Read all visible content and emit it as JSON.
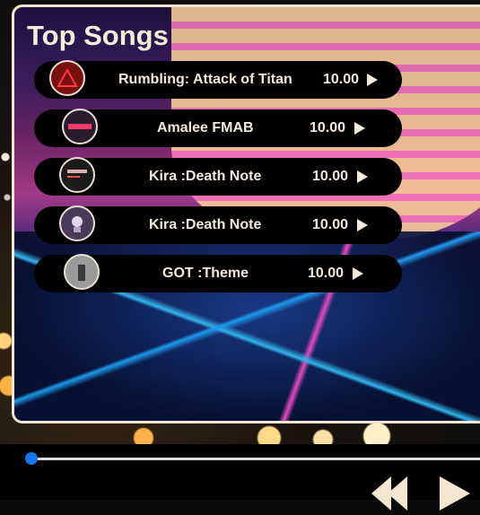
{
  "header": {
    "title": "Top Songs"
  },
  "songs": [
    {
      "title": "Rumbling: Attack of Titan",
      "rating": "10.00",
      "cover_icon": "alert-triangle-cover",
      "cover_color": "#7a0f0f"
    },
    {
      "title": "Amalee FMAB",
      "rating": "10.00",
      "cover_icon": "fmab-cover",
      "cover_color": "#2a1b2e"
    },
    {
      "title": "Kira :Death Note",
      "rating": "10.00",
      "cover_icon": "death-note-cover",
      "cover_color": "#1b1b1b"
    },
    {
      "title": "Kira :Death Note",
      "rating": "10.00",
      "cover_icon": "death-note-art-cover",
      "cover_color": "#4a3a5a"
    },
    {
      "title": "GOT :Theme",
      "rating": "10.00",
      "cover_icon": "got-cover",
      "cover_color": "#9a9a9a"
    }
  ],
  "player": {
    "progress": 0.0,
    "accent": "#1b74f0"
  }
}
